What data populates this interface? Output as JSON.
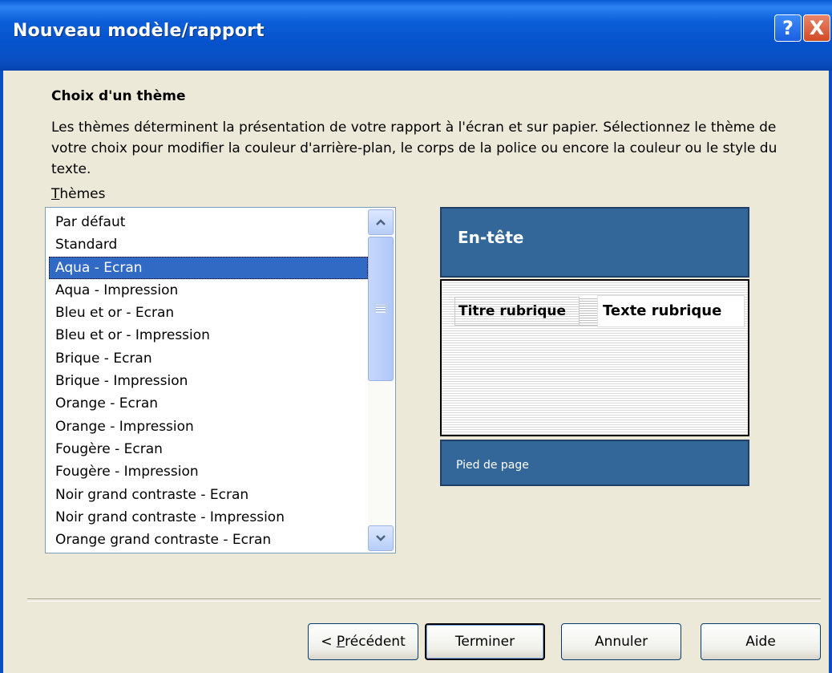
{
  "window": {
    "title": "Nouveau modèle/rapport",
    "help_glyph": "?",
    "close_glyph": "X"
  },
  "section": {
    "heading": "Choix d'un thème",
    "description": "Les thèmes déterminent la présentation de votre rapport à l'écran et sur papier. Sélectionnez le thème de votre choix pour modifier la couleur d'arrière-plan, le corps de la police ou encore la couleur ou le style du texte.",
    "list_label_accel": "T",
    "list_label_rest": "hèmes"
  },
  "themes": {
    "selected": "Aqua - Ecran",
    "items": [
      "Par défaut",
      "Standard",
      "Aqua - Ecran",
      "Aqua - Impression",
      "Bleu et or - Ecran",
      "Bleu et or - Impression",
      "Brique - Ecran",
      "Brique - Impression",
      "Orange - Ecran",
      "Orange - Impression",
      "Fougère - Ecran",
      "Fougère - Impression",
      "Noir grand contraste - Ecran",
      "Noir grand contraste - Impression",
      "Orange grand contraste - Ecran"
    ]
  },
  "preview": {
    "header": "En-tête",
    "field_title": "Titre rubrique",
    "field_text": "Texte rubrique",
    "footer": "Pied de page",
    "accent_color": "#336699"
  },
  "buttons": {
    "prev_prefix": "< ",
    "prev_accel": "P",
    "prev_rest": "récédent",
    "finish": "Terminer",
    "cancel": "Annuler",
    "help": "Aide"
  },
  "icons": {
    "scroll_up": "chevron-up-icon",
    "scroll_down": "chevron-down-icon"
  }
}
